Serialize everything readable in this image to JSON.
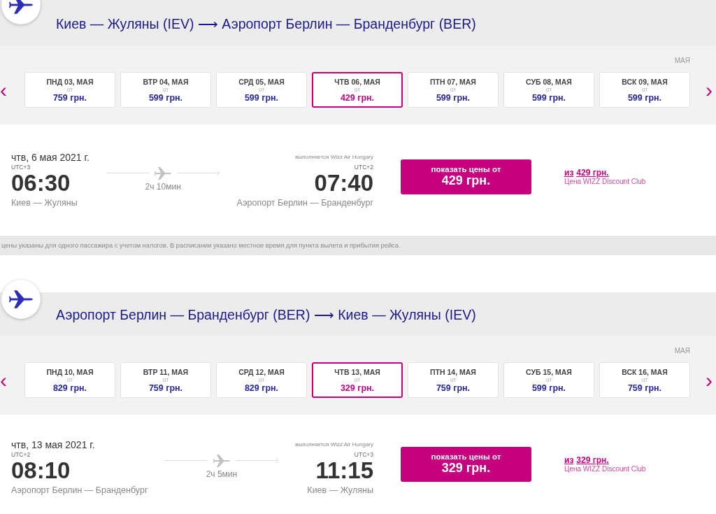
{
  "sections": [
    {
      "route": "Киев — Жуляны (IEV) ⟶ Аэропорт Берлин — Бранденбург (BER)",
      "month": "МАЯ",
      "prev": "‹",
      "next": "›",
      "days": [
        {
          "label": "ПНД 03, МАЯ",
          "from": "от",
          "price": "759 грн.",
          "selected": false
        },
        {
          "label": "ВТР 04, МАЯ",
          "from": "от",
          "price": "599 грн.",
          "selected": false
        },
        {
          "label": "СРД 05, МАЯ",
          "from": "от",
          "price": "599 грн.",
          "selected": false
        },
        {
          "label": "ЧТВ 06, МАЯ",
          "from": "от",
          "price": "429 грн.",
          "selected": true
        },
        {
          "label": "ПТН 07, МАЯ",
          "from": "от",
          "price": "599 грн.",
          "selected": false
        },
        {
          "label": "СУБ 08, МАЯ",
          "from": "от",
          "price": "599 грн.",
          "selected": false
        },
        {
          "label": "ВСК 09, МАЯ",
          "from": "от",
          "price": "599 грн.",
          "selected": false
        }
      ],
      "flight": {
        "date": "чтв, 6 мая 2021 г.",
        "operator": "выполняется Wizz Air Hungary",
        "dep_utc": "UTC+3",
        "dep_time": "06:30",
        "dep_place": "Киев — Жуляны",
        "duration": "2ч 10мин",
        "arr_utc": "UTC+2",
        "arr_time": "07:40",
        "arr_place": "Аэропорт Берлин — Бранденбург",
        "button_label": "показать цены от",
        "button_price": "429 грн.",
        "club_prefix": "из",
        "club_price": "429 грн.",
        "club_label": "Цена WIZZ Discount Club"
      },
      "note": "цены указаны для одного пассажира с учетом налогов. В расписании указано местное время для пункта вылета и прибытия рейса."
    },
    {
      "route": "Аэропорт Берлин — Бранденбург (BER) ⟶ Киев — Жуляны (IEV)",
      "month": "МАЯ",
      "prev": "‹",
      "next": "›",
      "days": [
        {
          "label": "ПНД 10, МАЯ",
          "from": "от",
          "price": "829 грн.",
          "selected": false
        },
        {
          "label": "ВТР 11, МАЯ",
          "from": "от",
          "price": "759 грн.",
          "selected": false
        },
        {
          "label": "СРД 12, МАЯ",
          "from": "от",
          "price": "829 грн.",
          "selected": false
        },
        {
          "label": "ЧТВ 13, МАЯ",
          "from": "от",
          "price": "329 грн.",
          "selected": true
        },
        {
          "label": "ПТН 14, МАЯ",
          "from": "от",
          "price": "759 грн.",
          "selected": false
        },
        {
          "label": "СУБ 15, МАЯ",
          "from": "от",
          "price": "599 грн.",
          "selected": false
        },
        {
          "label": "ВСК 16, МАЯ",
          "from": "от",
          "price": "759 грн.",
          "selected": false
        }
      ],
      "flight": {
        "date": "чтв, 13 мая 2021 г.",
        "operator": "выполняется Wizz Air Hungary",
        "dep_utc": "UTC+2",
        "dep_time": "08:10",
        "dep_place": "Аэропорт Берлин — Бранденбург",
        "duration": "2ч 5мин",
        "arr_utc": "UTC+3",
        "arr_time": "11:15",
        "arr_place": "Киев — Жуляны",
        "button_label": "показать цены от",
        "button_price": "329 грн.",
        "club_prefix": "из",
        "club_price": "329 грн.",
        "club_label": "Цена WIZZ Discount Club"
      }
    }
  ]
}
